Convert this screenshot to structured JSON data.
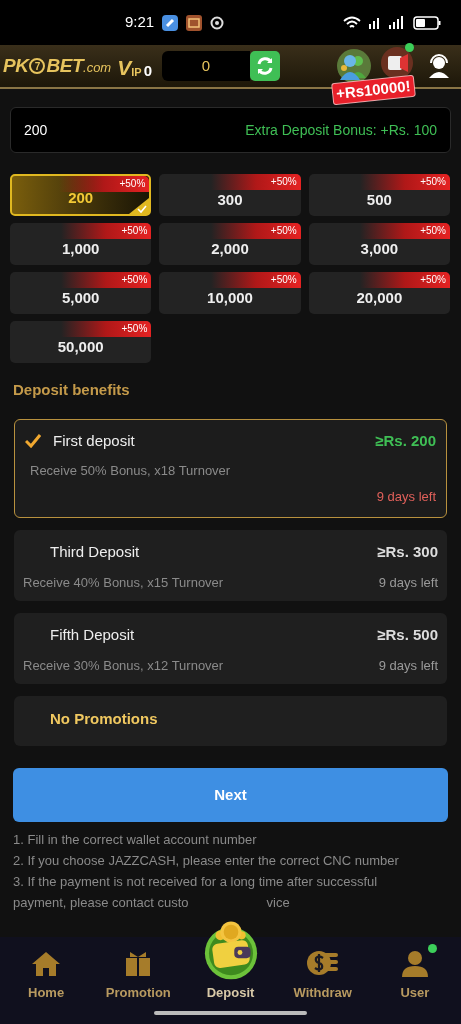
{
  "status_bar": {
    "time": "9:21"
  },
  "header": {
    "logo": [
      "PK",
      "7",
      "BET",
      ".com"
    ],
    "vip": {
      "label": "IP",
      "prefix": "V",
      "level": "0"
    },
    "balance": "0",
    "promo_badge": "+Rs10000!",
    "notification_dot": true
  },
  "amount_field": {
    "value": "200",
    "bonus_text": "Extra Deposit Bonus: +Rs. 100"
  },
  "amounts": [
    {
      "value": "200",
      "badge": "+50%",
      "selected": true
    },
    {
      "value": "300",
      "badge": "+50%",
      "selected": false
    },
    {
      "value": "500",
      "badge": "+50%",
      "selected": false
    },
    {
      "value": "1,000",
      "badge": "+50%",
      "selected": false
    },
    {
      "value": "2,000",
      "badge": "+50%",
      "selected": false
    },
    {
      "value": "3,000",
      "badge": "+50%",
      "selected": false
    },
    {
      "value": "5,000",
      "badge": "+50%",
      "selected": false
    },
    {
      "value": "10,000",
      "badge": "+50%",
      "selected": false
    },
    {
      "value": "20,000",
      "badge": "+50%",
      "selected": false
    },
    {
      "value": "50,000",
      "badge": "+50%",
      "selected": false
    }
  ],
  "benefits_title": "Deposit benefits",
  "benefits": [
    {
      "kind": "offer",
      "title": "First deposit",
      "minimum": "≥Rs. 200",
      "description": "Receive 50% Bonus, x18 Turnover",
      "days_left": "9 days left",
      "selected": true
    },
    {
      "kind": "offer",
      "title": "Third Deposit",
      "minimum": "≥Rs. 300",
      "description": "Receive 40% Bonus, x15 Turnover",
      "days_left": "9 days left",
      "selected": false
    },
    {
      "kind": "offer",
      "title": "Fifth Deposit",
      "minimum": "≥Rs. 500",
      "description": "Receive 30% Bonus, x12 Turnover",
      "days_left": "9 days left",
      "selected": false
    },
    {
      "kind": "none",
      "title": "No Promotions",
      "selected": false
    }
  ],
  "next_button": "Next",
  "notes": [
    {
      "text": "1. Fill in the correct wallet account number"
    },
    {
      "text": "2. If you choose JAZZCASH, please enter the correct CNC number"
    },
    {
      "text": "3. If the payment is not received for a long time after successful"
    },
    {
      "text": "payment, please contact custo",
      "tail": "vice"
    }
  ],
  "nav": [
    {
      "kind": "home",
      "label": "Home",
      "selected": false,
      "dot": false
    },
    {
      "kind": "gift",
      "label": "Promotion",
      "selected": false,
      "dot": false
    },
    {
      "kind": "wallet",
      "label": "Deposit",
      "selected": true,
      "dot": false
    },
    {
      "kind": "coins",
      "label": "Withdraw",
      "selected": false,
      "dot": false
    },
    {
      "kind": "user",
      "label": "User",
      "selected": false,
      "dot": true
    }
  ]
}
